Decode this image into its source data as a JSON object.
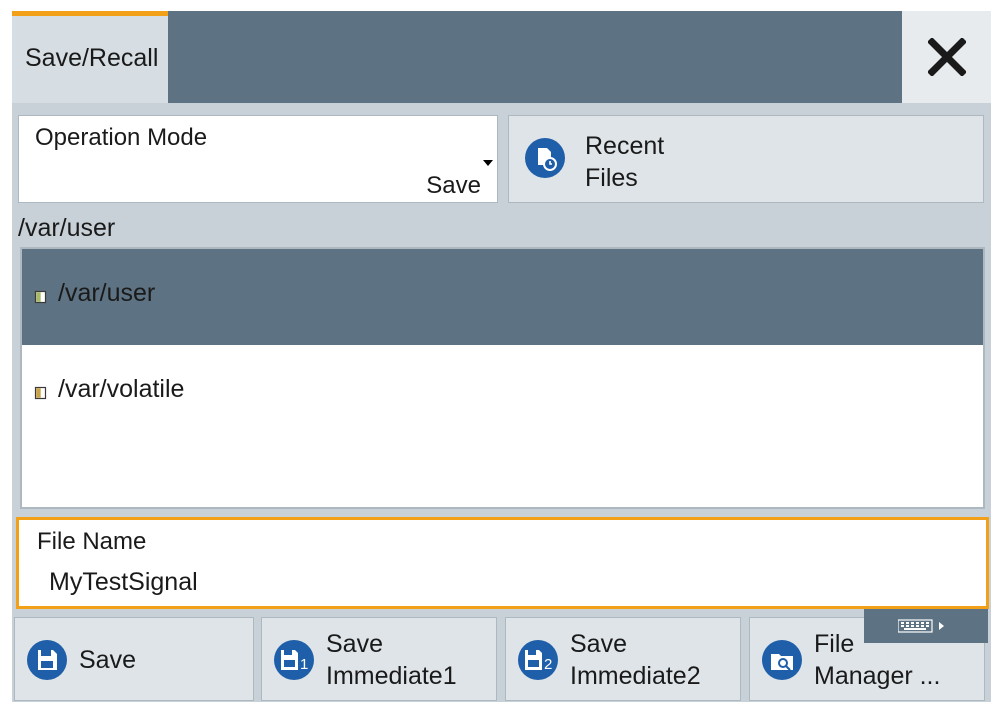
{
  "dialog": {
    "tab_label": "Save/Recall",
    "close_icon": "close-icon"
  },
  "operation_mode": {
    "label": "Operation Mode",
    "value": "Save"
  },
  "recent_files": {
    "line1": "Recent",
    "line2": "Files",
    "icon": "recent-files-icon"
  },
  "current_path": "/var/user",
  "file_list": {
    "items": [
      {
        "name": "/var/user",
        "selected": true,
        "icon": "folder-icon"
      },
      {
        "name": "/var/volatile",
        "selected": false,
        "icon": "folder-icon"
      }
    ]
  },
  "file_name": {
    "label": "File Name",
    "value": "MyTestSignal"
  },
  "buttons": {
    "save": {
      "label": "Save",
      "icon": "save-icon"
    },
    "save_immediate1": {
      "line1": "Save",
      "line2": "Immediate1",
      "icon": "save-immediate-1-icon"
    },
    "save_immediate2": {
      "line1": "Save",
      "line2": "Immediate2",
      "icon": "save-immediate-2-icon"
    },
    "file_manager": {
      "line1": "File",
      "line2": "Manager ...",
      "icon": "file-manager-icon"
    }
  },
  "keyboard": {
    "icon": "keyboard-icon"
  },
  "colors": {
    "accent": "#f2a017",
    "titlebar": "#5d7282",
    "icon_blue": "#1f5ea8",
    "panel": "#c9d1d8"
  }
}
